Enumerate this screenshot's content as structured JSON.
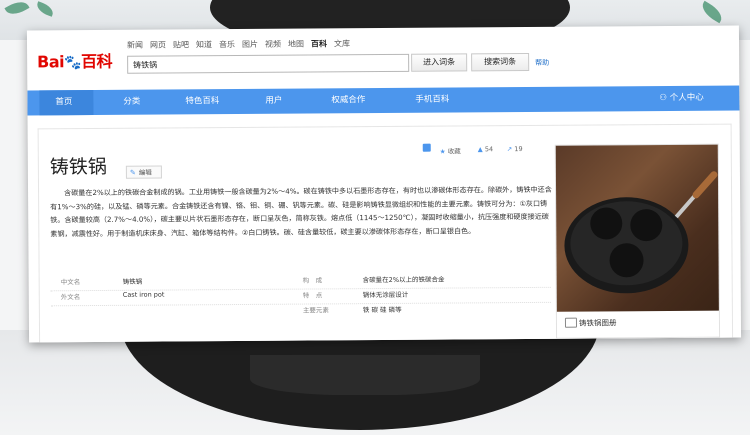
{
  "logo": {
    "part1": "Bai",
    "paw": "🐾",
    "part2": "百科"
  },
  "top_nav": [
    "新闻",
    "网页",
    "贴吧",
    "知道",
    "音乐",
    "图片",
    "视频",
    "地图",
    "百科",
    "文库"
  ],
  "top_nav_active": "百科",
  "search": {
    "value": "铸铁锅",
    "enter_label": "进入词条",
    "search_label": "搜索词条",
    "help_label": "帮助"
  },
  "blue_nav": [
    "首页",
    "分类",
    "特色百科",
    "用户",
    "权威合作",
    "手机百科"
  ],
  "user_center": "个人中心",
  "entry": {
    "title": "铸铁锅",
    "edit_label": "编辑",
    "favorite_label": "收藏",
    "like_count": "54",
    "share_count": "19",
    "paragraph": "含碳量在2%以上的铁碳合金制成的锅。工业用铸铁一般含碳量为2%～4%。碳在铸铁中多以石墨形态存在，有时也以渗碳体形态存在。除碳外，铸铁中还含有1%～3%的硅，以及锰、磷等元素。合金铸铁还含有镍、铬、钼、铜、硼、钒等元素。碳、硅是影响铸铁显微组织和性能的主要元素。铸铁可分为：①灰口铸铁。含碳量较高（2.7%～4.0%），碳主要以片状石墨形态存在，断口呈灰色，简称灰铁。熔点低（1145～1250℃），凝固时收缩量小，抗压强度和硬度接近碳素钢，减震性好。用于制造机床床身、汽缸、箱体等结构件。②白口铸铁。碳、硅含量较低，碳主要以渗碳体形态存在，断口呈银白色。"
  },
  "infobox": {
    "rows": [
      {
        "k1": "中文名",
        "v1": "铸铁锅",
        "k2": "构　成",
        "v2": "含碳量在2%以上的铁碳合金"
      },
      {
        "k1": "外文名",
        "v1": "Cast iron pot",
        "k2": "特　点",
        "v2": "锅体无涂层设计"
      },
      {
        "k1": "",
        "v1": "",
        "k2": "主要元素",
        "v2": "铁 碳 硅 磷等"
      }
    ]
  },
  "album": {
    "caption": "铸铁锅图册"
  },
  "colors": {
    "brand_blue": "#4c96ed",
    "logo_red": "#e10601",
    "logo_blue": "#2932e1"
  }
}
